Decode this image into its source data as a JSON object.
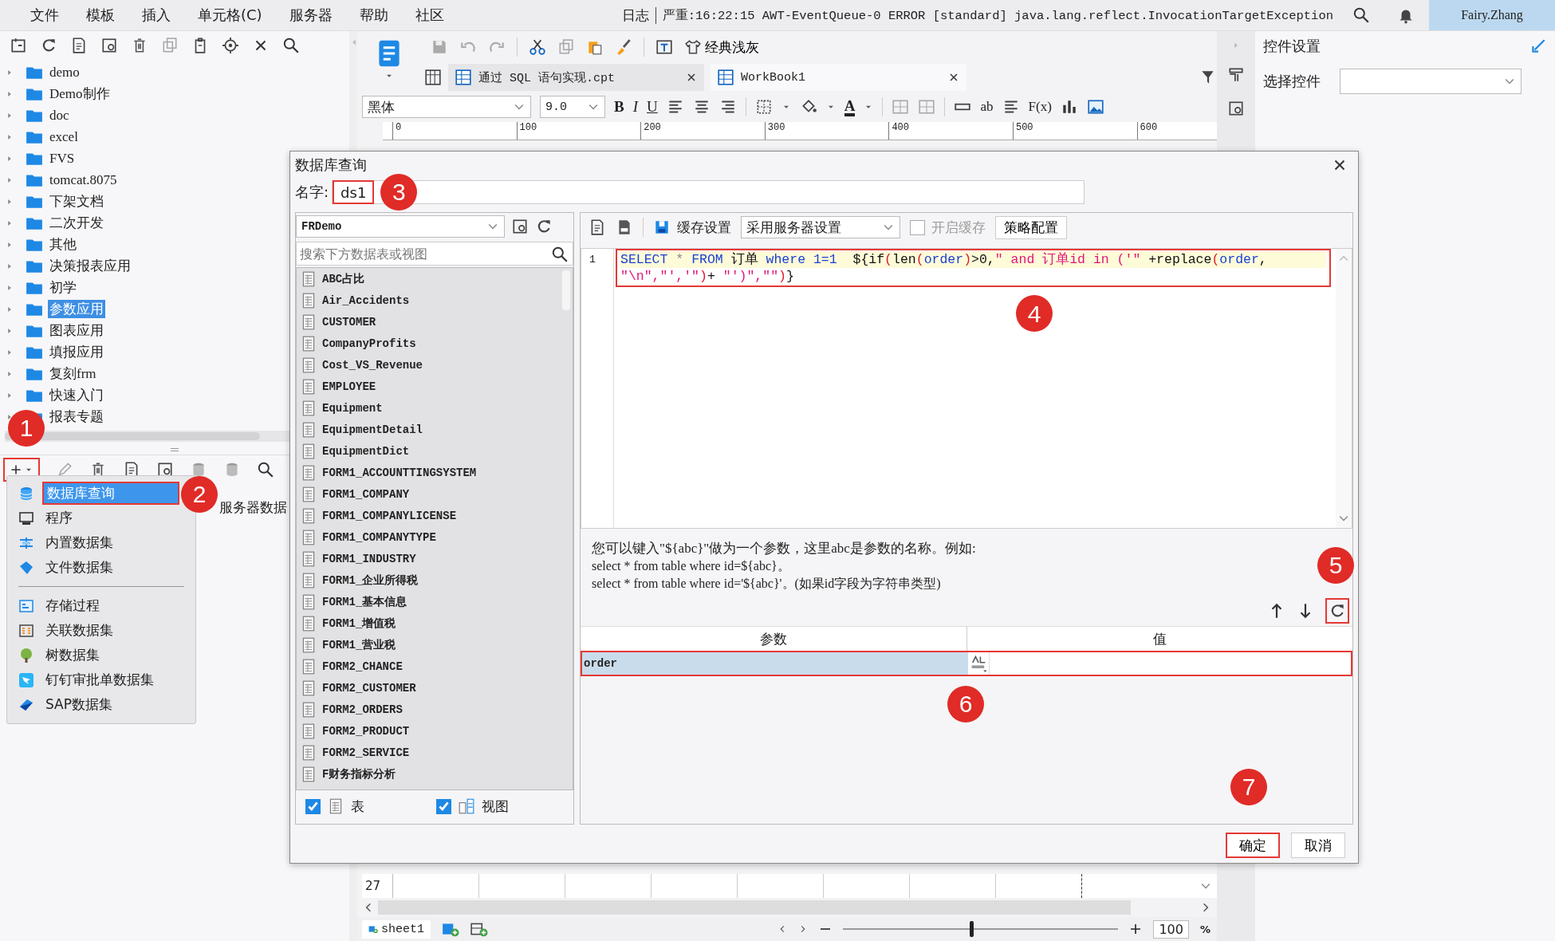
{
  "menu_bar": {
    "items": [
      "文件",
      "模板",
      "插入",
      "单元格(C)",
      "服务器",
      "帮助",
      "社区"
    ],
    "log_label": "日志",
    "log_message": "严重:16:22:15 AWT-EventQueue-0 ERROR [standard] java.lang.reflect.InvocationTargetException",
    "user": "Fairy.Zhang"
  },
  "file_tree": [
    {
      "label": "demo",
      "selected": false
    },
    {
      "label": "Demo制作",
      "selected": false
    },
    {
      "label": "doc",
      "selected": false
    },
    {
      "label": "excel",
      "selected": false
    },
    {
      "label": "FVS",
      "selected": false
    },
    {
      "label": "tomcat.8075",
      "selected": false
    },
    {
      "label": "下架文档",
      "selected": false
    },
    {
      "label": "二次开发",
      "selected": false
    },
    {
      "label": "其他",
      "selected": false
    },
    {
      "label": "决策报表应用",
      "selected": false
    },
    {
      "label": "初学",
      "selected": false
    },
    {
      "label": "参数应用",
      "selected": true
    },
    {
      "label": "图表应用",
      "selected": false
    },
    {
      "label": "填报应用",
      "selected": false
    },
    {
      "label": "复刻frm",
      "selected": false
    },
    {
      "label": "快速入门",
      "selected": false
    },
    {
      "label": "报表专题",
      "selected": false
    }
  ],
  "dataset_toolbar": {
    "add_button": {
      "highlighted": true,
      "callout": "1"
    }
  },
  "dataset_list": {
    "item": "服务器数据"
  },
  "dataset_menu": [
    {
      "label": "数据库查询",
      "kind": "database",
      "selected": true,
      "highlighted": true,
      "callout": "2"
    },
    {
      "label": "程序",
      "kind": "program",
      "selected": false,
      "highlighted": false
    },
    {
      "label": "内置数据集",
      "kind": "builtin",
      "selected": false,
      "highlighted": false
    },
    {
      "label": "文件数据集",
      "kind": "file",
      "selected": false,
      "highlighted": false
    },
    {
      "label": "存储过程",
      "kind": "procedure",
      "selected": false,
      "highlighted": false,
      "separator_before": true
    },
    {
      "label": "关联数据集",
      "kind": "relation",
      "selected": false,
      "highlighted": false
    },
    {
      "label": "树数据集",
      "kind": "tree",
      "selected": false,
      "highlighted": false
    },
    {
      "label": "钉钉审批单数据集",
      "kind": "dingtalk",
      "selected": false,
      "highlighted": false
    },
    {
      "label": "SAP数据集",
      "kind": "sap",
      "selected": false,
      "highlighted": false
    }
  ],
  "designer": {
    "theme_button": "经典浅灰",
    "tabs": [
      {
        "label": "通过 SQL 语句实现.cpt",
        "selected": false
      },
      {
        "label": "WorkBook1",
        "selected": true
      }
    ],
    "font": "黑体",
    "font_size": "9.0",
    "format_buttons": [
      "B",
      "I",
      "U"
    ],
    "font_color": "A",
    "text_button": "ab",
    "formula_button": "F(x)",
    "ruler_marks": [
      "0",
      "100",
      "200",
      "300",
      "400",
      "500",
      "600"
    ],
    "row_number": "27",
    "sheet_tab": "sheet1",
    "zoom_slider": {
      "level": 0.46
    },
    "zoom_value": "100",
    "zoom_unit": "%"
  },
  "widget_panel": {
    "title": "控件设置",
    "select_label": "选择控件"
  },
  "dialog": {
    "title": "数据库查询",
    "name_label": "名字:",
    "name": "ds1",
    "name_highlighted": true,
    "name_callout": "3",
    "connection": "FRDemo",
    "search_placeholder": "搜索下方数据表或视图",
    "tables": [
      "ABC占比",
      "Air_Accidents",
      "CUSTOMER",
      "CompanyProfits",
      "Cost_VS_Revenue",
      "EMPLOYEE",
      "Equipment",
      "EquipmentDetail",
      "EquipmentDict",
      "FORM1_ACCOUNTTINGSYSTEM",
      "FORM1_COMPANY",
      "FORM1_COMPANYLICENSE",
      "FORM1_COMPANYTYPE",
      "FORM1_INDUSTRY",
      "FORM1_企业所得税",
      "FORM1_基本信息",
      "FORM1_增值税",
      "FORM1_营业税",
      "FORM2_CHANCE",
      "FORM2_CUSTOMER",
      "FORM2_ORDERS",
      "FORM2_PRODUCT",
      "FORM2_SERVICE",
      "F财务指标分析"
    ],
    "show_tables": {
      "label": "表",
      "checked": true
    },
    "show_views": {
      "label": "视图",
      "checked": true
    },
    "cache_label": "缓存设置",
    "cache_mode": "采用服务器设置",
    "enable_cache": {
      "label": "开启缓存",
      "checked": false
    },
    "strategy_button": "策略配置",
    "sql": {
      "line_number": "1",
      "highlighted": true,
      "callout": "4",
      "tokens": [
        {
          "kind": "keyword",
          "text": "SELECT"
        },
        {
          "kind": "operator",
          "text": " * "
        },
        {
          "kind": "keyword",
          "text": "FROM"
        },
        {
          "kind": "plain",
          "text": " 订单 "
        },
        {
          "kind": "keyword",
          "text": "where 1=1"
        },
        {
          "kind": "plain",
          "text": "  ${if"
        },
        {
          "kind": "paren",
          "text": "("
        },
        {
          "kind": "plain",
          "text": "len"
        },
        {
          "kind": "paren",
          "text": "("
        },
        {
          "kind": "keyword",
          "text": "order"
        },
        {
          "kind": "paren",
          "text": ")"
        },
        {
          "kind": "plain",
          "text": ">0,"
        },
        {
          "kind": "string",
          "text": "\" and 订单id in ('\""
        },
        {
          "kind": "plain",
          "text": " +replace"
        },
        {
          "kind": "paren",
          "text": "("
        },
        {
          "kind": "keyword",
          "text": "order"
        },
        {
          "kind": "plain",
          "text": ","
        },
        {
          "kind": "string",
          "text": "\"\\n\",\"','\"",
          "wrap_before": true
        },
        {
          "kind": "paren",
          "text": ")"
        },
        {
          "kind": "plain",
          "text": "+ "
        },
        {
          "kind": "string",
          "text": "\"')\",\"\""
        },
        {
          "kind": "paren",
          "text": ")"
        },
        {
          "kind": "plain",
          "text": "}"
        }
      ]
    },
    "help": [
      "您可以键入\"${abc}\"做为一个参数，这里abc是参数的名称。例如:",
      "select * from table where id=${abc}。",
      "select * from table where id='${abc}'。(如果id字段为字符串类型)"
    ],
    "refresh_highlighted": true,
    "refresh_callout": "5",
    "params": {
      "columns": [
        "参数",
        "值"
      ],
      "rows": [
        {
          "name": "order",
          "selected": true,
          "highlighted": true,
          "callout": "6"
        }
      ]
    },
    "buttons": [
      {
        "label": "确定",
        "highlighted": true,
        "callout": "7"
      },
      {
        "label": "取消",
        "highlighted": false
      }
    ]
  }
}
